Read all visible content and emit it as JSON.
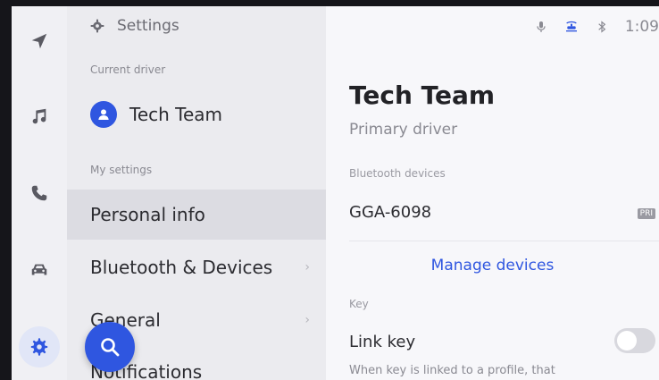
{
  "header": {
    "title": "Settings"
  },
  "status_bar": {
    "time": "1:09"
  },
  "current_driver": {
    "section_label": "Current driver",
    "name": "Tech Team"
  },
  "my_settings": {
    "section_label": "My settings",
    "items": [
      {
        "label": "Personal info",
        "selected": true
      },
      {
        "label": "Bluetooth & Devices",
        "chevron": "›"
      },
      {
        "label": "General",
        "chevron": "›"
      },
      {
        "label": "Notifications"
      }
    ]
  },
  "detail": {
    "title": "Tech Team",
    "subtitle": "Primary driver",
    "bluetooth_label": "Bluetooth devices",
    "device_name": "GGA-6098",
    "device_tag": "PRI",
    "manage_label": "Manage devices",
    "key_label": "Key",
    "link_key_label": "Link key",
    "link_key_on": false,
    "link_key_desc": "When key is linked to a profile, that"
  },
  "colors": {
    "accent": "#2f56e0",
    "panel": "#ebebef",
    "detail_bg": "#f7f7fa"
  }
}
